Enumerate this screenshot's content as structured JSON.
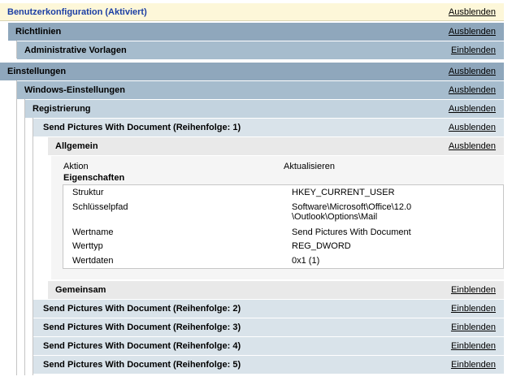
{
  "root": {
    "title": "Benutzerkonfiguration (Aktiviert)",
    "link": "Ausblenden"
  },
  "richtlinien": {
    "title": "Richtlinien",
    "link": "Ausblenden"
  },
  "admin_vorlagen": {
    "title": "Administrative Vorlagen",
    "link": "Einblenden"
  },
  "einstellungen": {
    "title": "Einstellungen",
    "link": "Ausblenden"
  },
  "windows_einstellungen": {
    "title": "Windows-Einstellungen",
    "link": "Ausblenden"
  },
  "registrierung": {
    "title": "Registrierung",
    "link": "Ausblenden"
  },
  "item1": {
    "title": "Send Pictures With Document (Reihenfolge: 1)",
    "link": "Ausblenden"
  },
  "allgemein": {
    "title": "Allgemein",
    "link": "Ausblenden",
    "aktion_label": "Aktion",
    "aktion_value": "Aktualisieren",
    "eigenschaften_label": "Eigenschaften",
    "props": [
      {
        "key": "Struktur",
        "value": "HKEY_CURRENT_USER"
      },
      {
        "key": "Schlüsselpfad",
        "value": "Software\\Microsoft\\Office\\12.0",
        "value2": "\\Outlook\\Options\\Mail"
      },
      {
        "key": "Wertname",
        "value": "Send Pictures With Document"
      },
      {
        "key": "Werttyp",
        "value": "REG_DWORD"
      },
      {
        "key": "Wertdaten",
        "value": "0x1 (1)"
      }
    ]
  },
  "gemeinsam": {
    "title": "Gemeinsam",
    "link": "Einblenden"
  },
  "item2": {
    "title": "Send Pictures With Document (Reihenfolge: 2)",
    "link": "Einblenden"
  },
  "item3": {
    "title": "Send Pictures With Document (Reihenfolge: 3)",
    "link": "Einblenden"
  },
  "item4": {
    "title": "Send Pictures With Document (Reihenfolge: 4)",
    "link": "Einblenden"
  },
  "item5": {
    "title": "Send Pictures With Document (Reihenfolge: 5)",
    "link": "Einblenden"
  }
}
